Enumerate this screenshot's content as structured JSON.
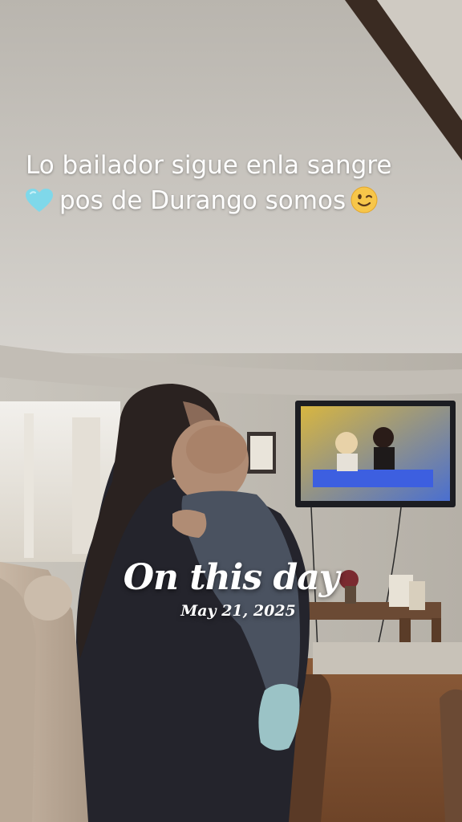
{
  "caption": {
    "line1": "Lo bailador sigue enla sangre",
    "line2": "pos de Durango somos",
    "heart_icon": "light-blue-heart-emoji",
    "wink_icon": "winking-face-emoji"
  },
  "memory": {
    "title": "On this day",
    "date": "May 21, 2025"
  },
  "colors": {
    "heart": "#7fd8ea",
    "wink_face": "#f7c64a",
    "text": "#ffffff"
  }
}
